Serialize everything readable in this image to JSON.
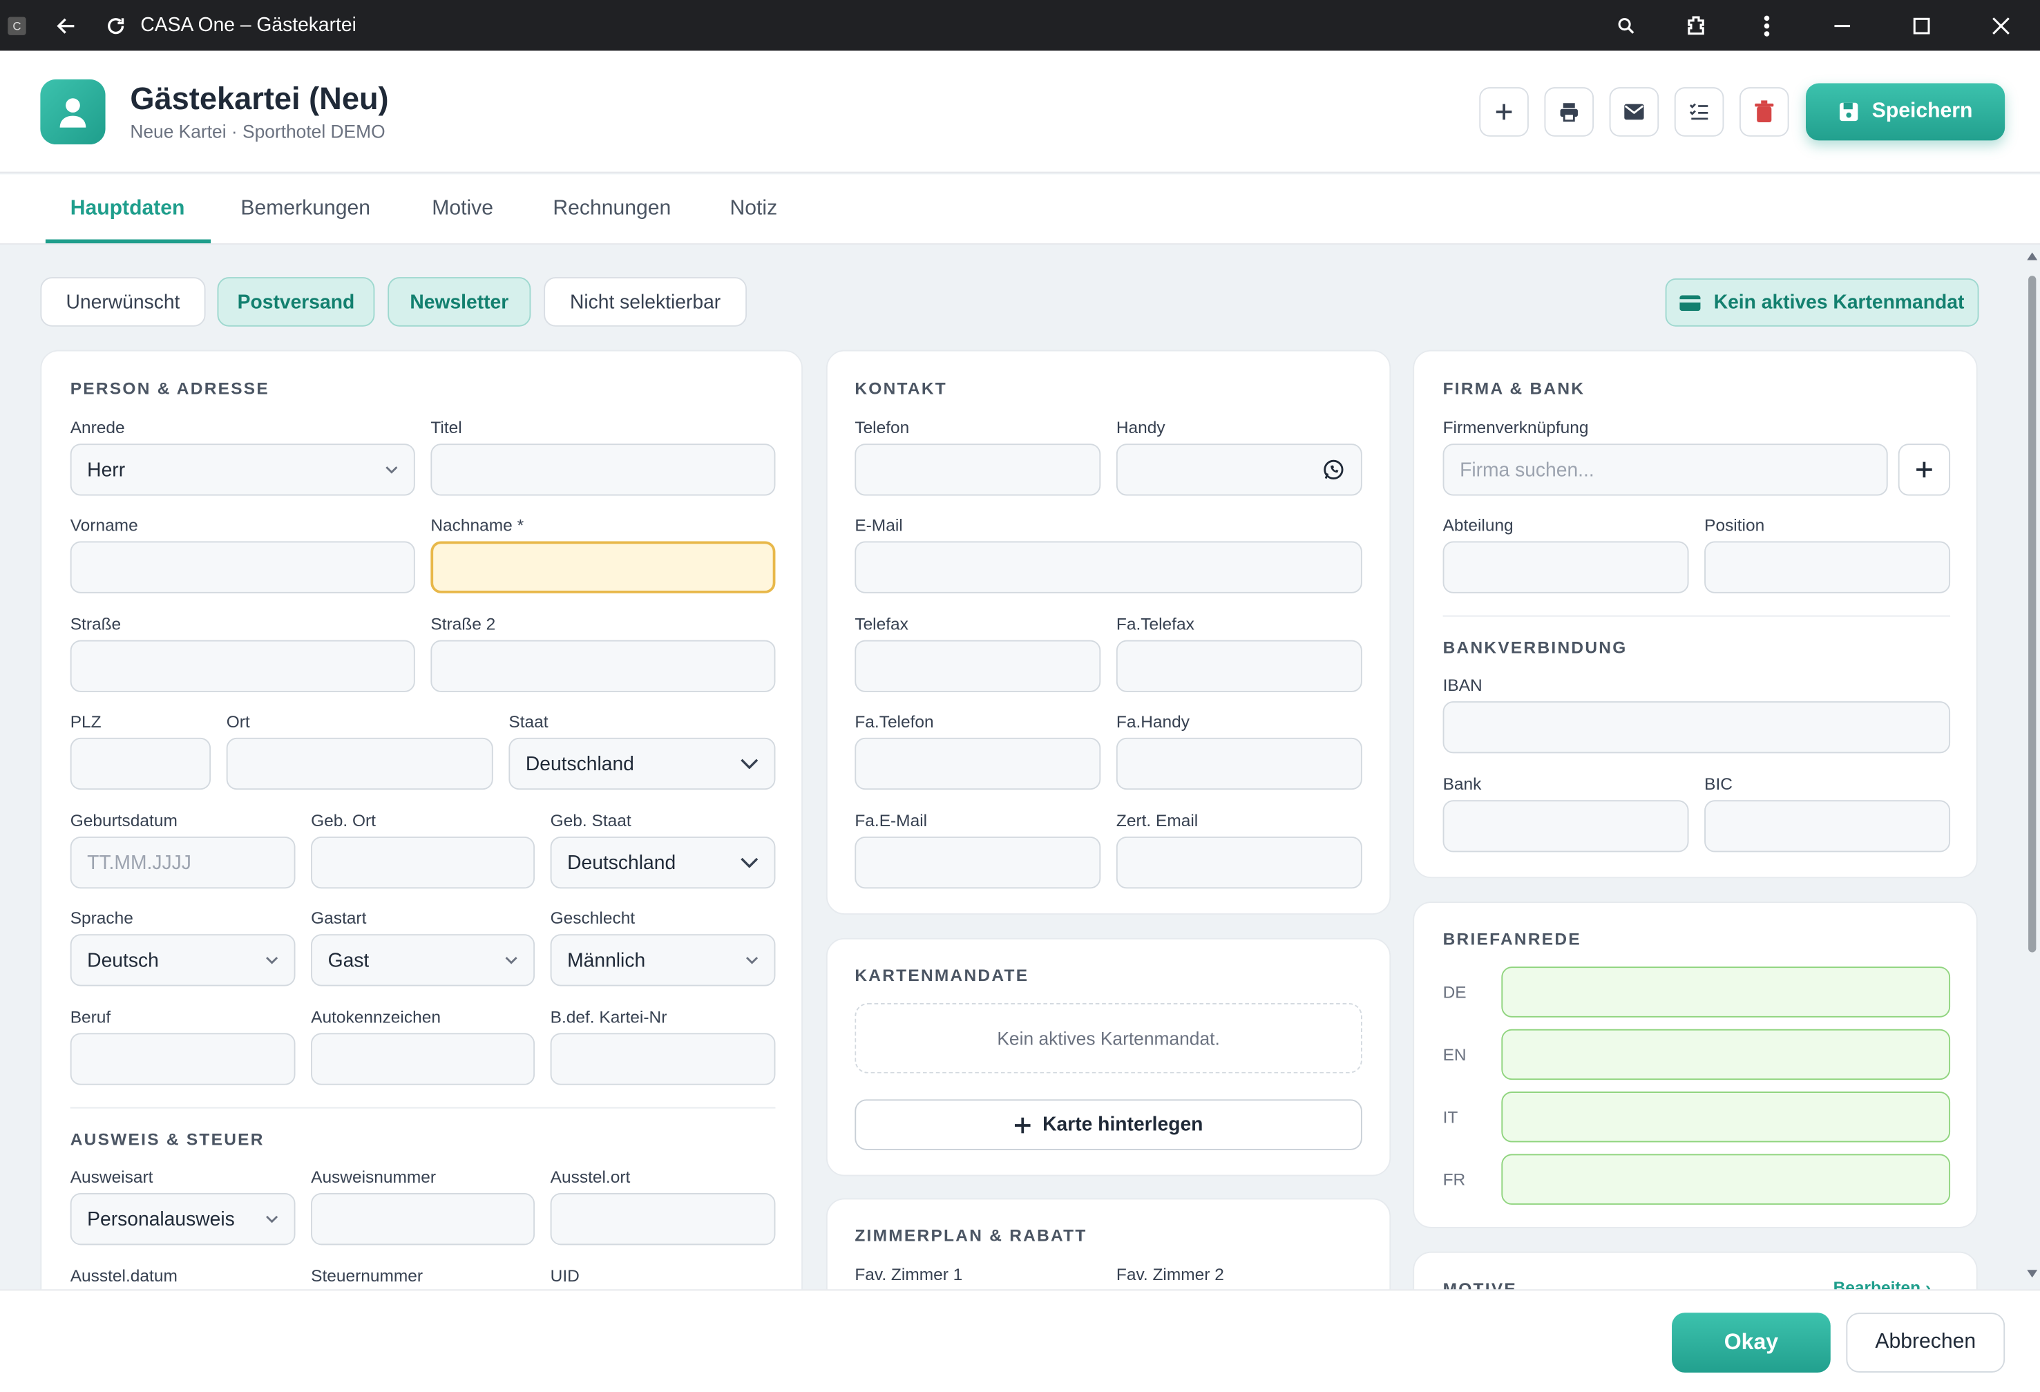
{
  "window": {
    "app_icon": "C",
    "title": "CASA One – Gästekartei"
  },
  "header": {
    "title": "Gästekartei (Neu)",
    "subtitle": "Neue Kartei · Sporthotel DEMO",
    "save_label": "Speichern",
    "accent_color": "#1f9e8c"
  },
  "tabs": [
    "Hauptdaten",
    "Bemerkungen",
    "Motive",
    "Rechnungen",
    "Notiz"
  ],
  "chips": {
    "unerwuenscht": "Unerwünscht",
    "postversand": "Postversand",
    "newsletter": "Newsletter",
    "nicht_selektierbar": "Nicht selektierbar",
    "mandate_status": "Kein aktives Kartenmandat"
  },
  "person": {
    "section": "PERSON & ADRESSE",
    "anrede_label": "Anrede",
    "anrede_value": "Herr",
    "titel_label": "Titel",
    "vorname_label": "Vorname",
    "nachname_label": "Nachname *",
    "strasse_label": "Straße",
    "strasse2_label": "Straße 2",
    "plz_label": "PLZ",
    "ort_label": "Ort",
    "staat_label": "Staat",
    "staat_value": "Deutschland",
    "geburtsdatum_label": "Geburtsdatum",
    "geburtsdatum_placeholder": "TT.MM.JJJJ",
    "geb_ort_label": "Geb. Ort",
    "geb_staat_label": "Geb. Staat",
    "geb_staat_value": "Deutschland",
    "sprache_label": "Sprache",
    "sprache_value": "Deutsch",
    "gastart_label": "Gastart",
    "gastart_value": "Gast",
    "geschlecht_label": "Geschlecht",
    "geschlecht_value": "Männlich",
    "beruf_label": "Beruf",
    "autokennzeichen_label": "Autokennzeichen",
    "bdef_label": "B.def. Kartei-Nr"
  },
  "ausweis": {
    "section": "AUSWEIS & STEUER",
    "ausweisart_label": "Ausweisart",
    "ausweisart_value": "Personalausweis",
    "ausweisnummer_label": "Ausweisnummer",
    "ausstelort_label": "Ausstel.ort",
    "ausstelldatum_label": "Ausstel.datum",
    "steuernummer_label": "Steuernummer",
    "uid_label": "UID"
  },
  "kontakt": {
    "section": "KONTAKT",
    "telefon_label": "Telefon",
    "handy_label": "Handy",
    "email_label": "E-Mail",
    "telefax_label": "Telefax",
    "fa_telefax_label": "Fa.Telefax",
    "fa_telefon_label": "Fa.Telefon",
    "fa_handy_label": "Fa.Handy",
    "fa_email_label": "Fa.E-Mail",
    "zert_email_label": "Zert. Email"
  },
  "kartenmandate": {
    "section": "KARTENMANDATE",
    "empty_text": "Kein aktives Kartenmandat.",
    "add_card_label": "Karte hinterlegen"
  },
  "zimmerplan": {
    "section": "ZIMMERPLAN & RABATT",
    "fav1_label": "Fav. Zimmer 1",
    "fav2_label": "Fav. Zimmer 2"
  },
  "firma": {
    "section": "FIRMA & BANK",
    "firmenverknuepfung_label": "Firmenverknüpfung",
    "firma_placeholder": "Firma suchen...",
    "abteilung_label": "Abteilung",
    "position_label": "Position",
    "bank_section": "BANKVERBINDUNG",
    "iban_label": "IBAN",
    "bank_label": "Bank",
    "bic_label": "BIC"
  },
  "briefanrede": {
    "section": "BRIEFANREDE",
    "langs": [
      "DE",
      "EN",
      "IT",
      "FR"
    ]
  },
  "motive": {
    "section": "MOTIVE",
    "edit_label": "Bearbeiten ›"
  },
  "footer": {
    "ok_label": "Okay",
    "cancel_label": "Abbrechen"
  }
}
